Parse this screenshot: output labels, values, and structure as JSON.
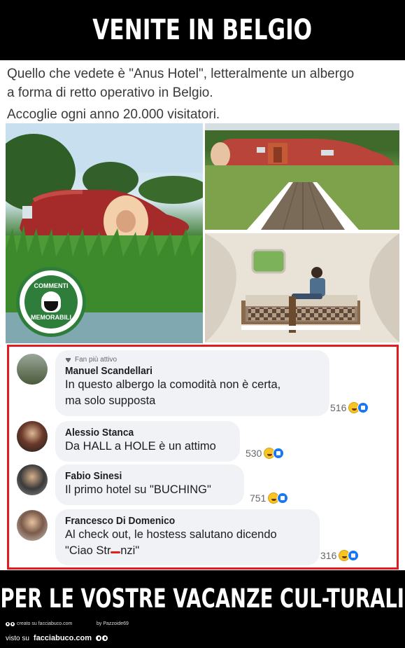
{
  "header": {
    "title": "VENITE IN BELGIO"
  },
  "caption": {
    "line1": "Quello che vedete è \"Anus Hotel\", letteralmente un albergo",
    "line2": "a forma di retto operativo in Belgio.",
    "line3": "Accoglie ogni anno 20.000 visitatori."
  },
  "logo": {
    "top_text": "COMMENTI",
    "bottom_text": "MEMORABILI"
  },
  "comments": [
    {
      "badge": "Fan più attivo",
      "author": "Manuel Scandellari",
      "lines": [
        "In questo albergo la comodità non è certa,",
        "ma solo supposta"
      ],
      "count": "516"
    },
    {
      "author": "Alessio Stanca",
      "lines": [
        "Da HALL a HOLE è un attimo"
      ],
      "count": "530"
    },
    {
      "author": "Fabio Sinesi",
      "lines": [
        "Il primo hotel su \"BUCHING\""
      ],
      "count": "751"
    },
    {
      "author": "Francesco Di Domenico",
      "lines": [
        "Al check out, le hostess salutano dicendo",
        "\"Ciao Str",
        "nzi\""
      ],
      "count": "316"
    }
  ],
  "footer_banner": {
    "title": "PER LE VOSTRE VACANZE CUL-TURALI"
  },
  "footer": {
    "credit": "creato su facciabuco.com",
    "creator": "by Pazzoide69",
    "visto_label": "visto su",
    "site": "facciabuco.com"
  },
  "colors": {
    "frame": "#e21b23",
    "bubble": "#f0f2f5",
    "like": "#1877f2",
    "logo_green": "#2f7d3a"
  }
}
